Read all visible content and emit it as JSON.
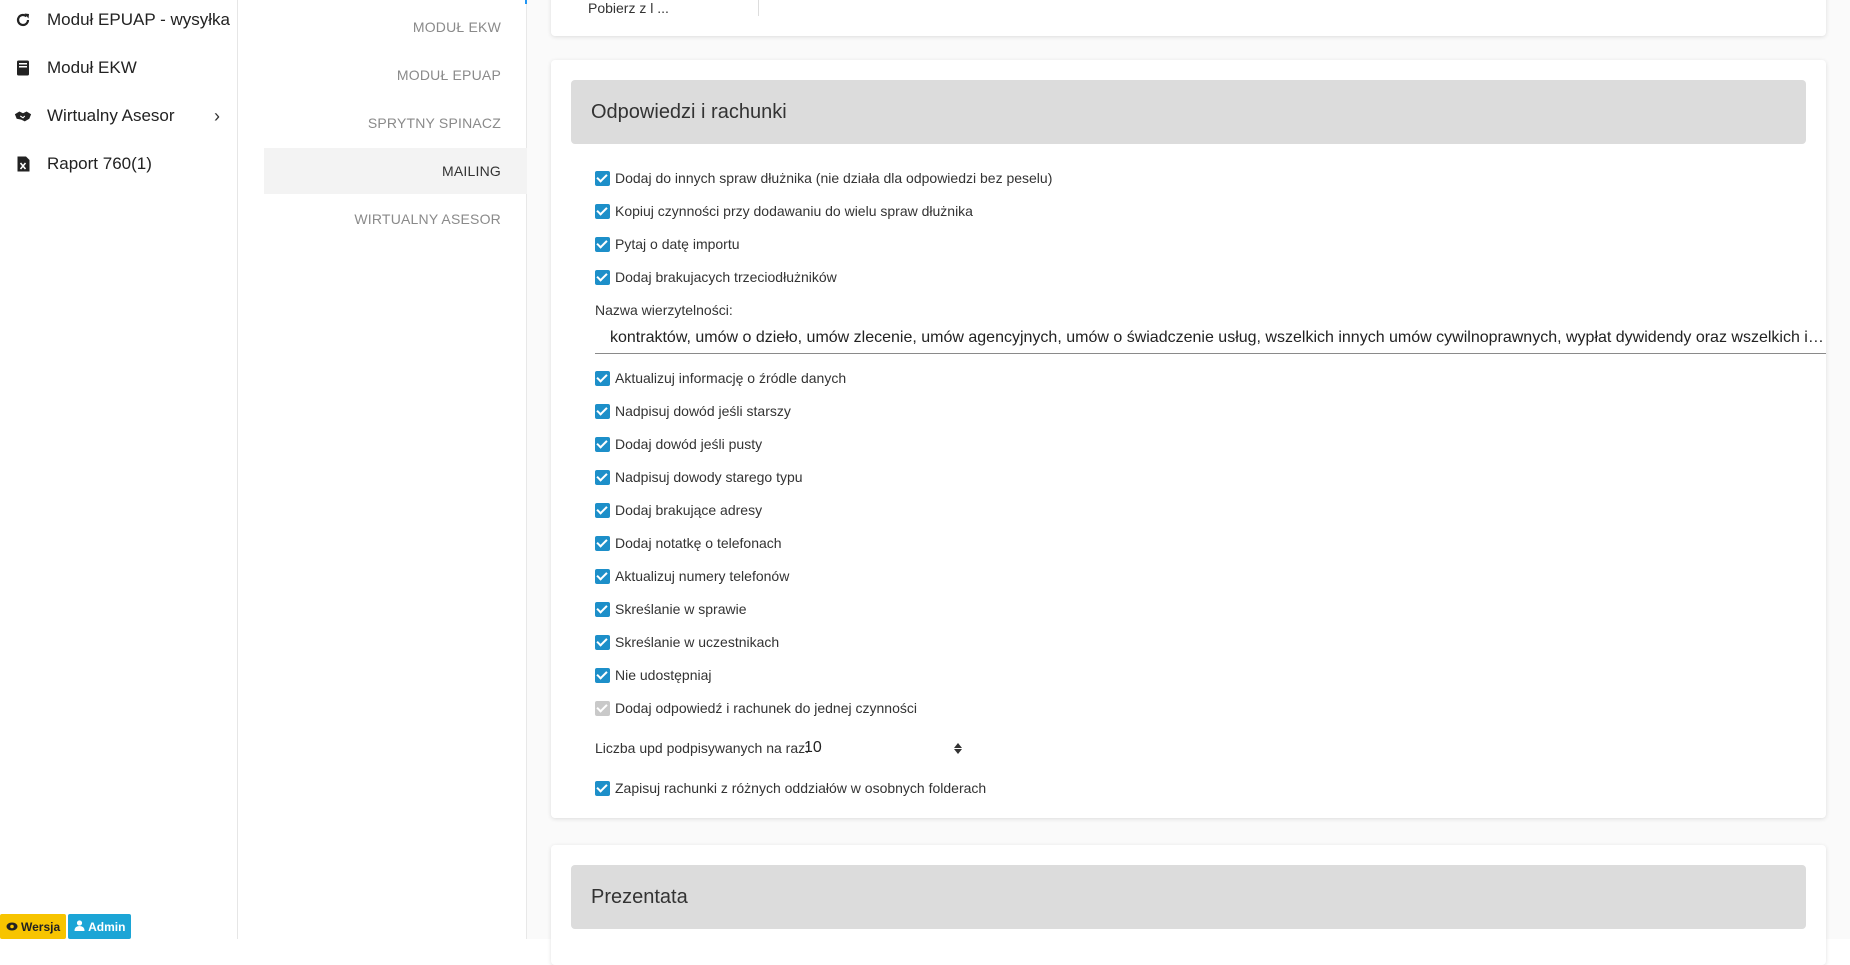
{
  "sidebar": {
    "items": [
      {
        "label": "Moduł EPUAP - wysyłka",
        "icon": "refresh-icon"
      },
      {
        "label": "Moduł EKW",
        "icon": "book-icon"
      },
      {
        "label": "Wirtualny Asesor",
        "icon": "handshake-icon",
        "chevron": "›"
      },
      {
        "label": "Raport 760(1)",
        "icon": "excel-file-icon"
      }
    ],
    "badges": {
      "version": "Wersja",
      "role": "Admin"
    }
  },
  "subnav": {
    "items": [
      "MODUŁ EKW",
      "MODUŁ EPUAP",
      "SPRYTNY SPINACZ",
      "MAILING",
      "WIRTUALNY ASESOR"
    ],
    "active": "MAILING"
  },
  "top_card": {
    "cut_text": "Pobierz z l ..."
  },
  "section_responses": {
    "title": "Odpowiedzi i rachunki",
    "checkboxes_a": [
      "Dodaj do innych spraw dłużnika (nie działa dla odpowiedzi bez peselu)",
      "Kopiuj czynności przy dodawaniu do wielu spraw dłużnika",
      "Pytaj o datę importu",
      "Dodaj brakujacych trzeciodłużników"
    ],
    "claim_name_label": "Nazwa wierzytelności:",
    "claim_name_value": "kontraktów, umów o dzieło, umów zlecenie, umów agencyjnych, umów o świadczenie usług, wszelkich innych umów cywilnoprawnych, wypłat dywidendy oraz wszelkich innych wierzytelności",
    "checkboxes_b": [
      "Aktualizuj informację o źródle danych",
      "Nadpisuj dowód jeśli starszy",
      "Dodaj dowód jeśli pusty",
      "Nadpisuj dowody starego typu",
      "Dodaj brakujące adresy",
      "Dodaj notatkę o telefonach",
      "Aktualizuj numery telefonów",
      "Skreślanie w sprawie",
      "Skreślanie w uczestnikach",
      "Nie udostępniaj"
    ],
    "disabled_checkbox": "Dodaj odpowiedź i rachunek do jednej czynności",
    "batch_label": "Liczba upd podpisywanych na raz:",
    "batch_value": "10",
    "last_checkbox": "Zapisuj rachunki z różnych oddziałów w osobnych folderach"
  },
  "section_presenter": {
    "title": "Prezentata"
  },
  "colors": {
    "checkbox": "#1d8fc9",
    "header_bg": "#dcdcdc",
    "badge_version": "#f7c400",
    "badge_admin": "#1ca5d6"
  }
}
